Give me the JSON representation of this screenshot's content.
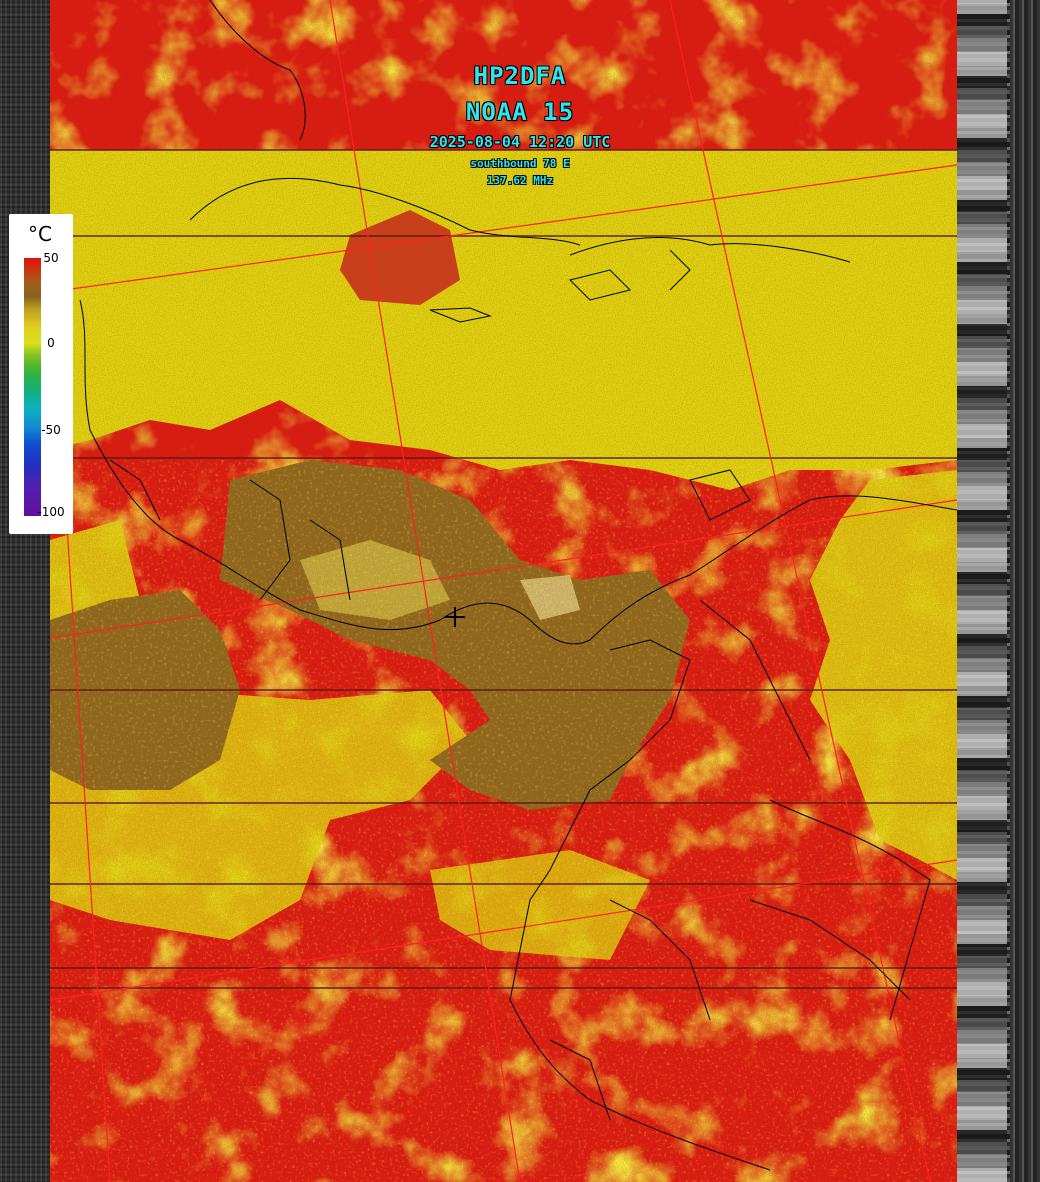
{
  "overlay": {
    "station": "HP2DFA",
    "satellite": "NOAA 15",
    "datetime": "2025-08-04 12:20 UTC",
    "pass": "southbound 78 E",
    "frequency": "137.62 MHz"
  },
  "legend": {
    "unit": "°C",
    "ticks": [
      "50",
      "0",
      "-50",
      "-100"
    ],
    "scale_max": 50,
    "scale_min": -100
  },
  "palette": {
    "hot_red": "#d81a10",
    "warm_orange": "#e8401a",
    "yellow": "#dcd60e",
    "olive": "#8a6a1e",
    "grid_line": "#ff2020",
    "coast": "#000000",
    "overlay_text": "#2ee6f0"
  },
  "marker": {
    "name": "station-location-cross"
  }
}
